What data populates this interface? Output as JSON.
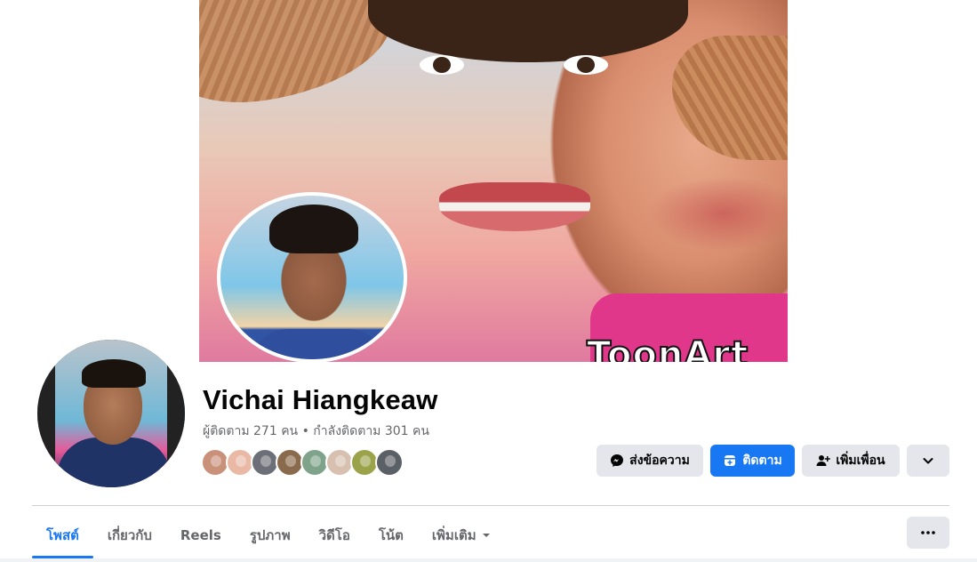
{
  "profile": {
    "name": "Vichai Hiangkeaw",
    "stats": "ผู้ติดตาม 271 คน • กำลังติดตาม 301 คน",
    "cover_watermark": "ToonArt"
  },
  "mutual_friends": [
    {
      "color": "#c9907a"
    },
    {
      "color": "#e9b9a6"
    },
    {
      "color": "#6c6f78"
    },
    {
      "color": "#8a6a4c"
    },
    {
      "color": "#7fa38a"
    },
    {
      "color": "#d8c0b0"
    },
    {
      "color": "#9aa34a"
    },
    {
      "color": "#5b5f66"
    }
  ],
  "actions": {
    "message_label": "ส่งข้อความ",
    "follow_label": "ติดตาม",
    "add_friend_label": "เพิ่มเพื่อน"
  },
  "tabs": [
    {
      "label": "โพสต์",
      "active": true
    },
    {
      "label": "เกี่ยวกับ",
      "active": false
    },
    {
      "label": "Reels",
      "active": false
    },
    {
      "label": "รูปภาพ",
      "active": false
    },
    {
      "label": "วิดีโอ",
      "active": false
    },
    {
      "label": "โน้ต",
      "active": false
    },
    {
      "label": "เพิ่มเติม",
      "active": false
    }
  ],
  "colors": {
    "accent": "#1877f2",
    "secondary_button": "#e4e6eb",
    "muted_text": "#65676b"
  }
}
